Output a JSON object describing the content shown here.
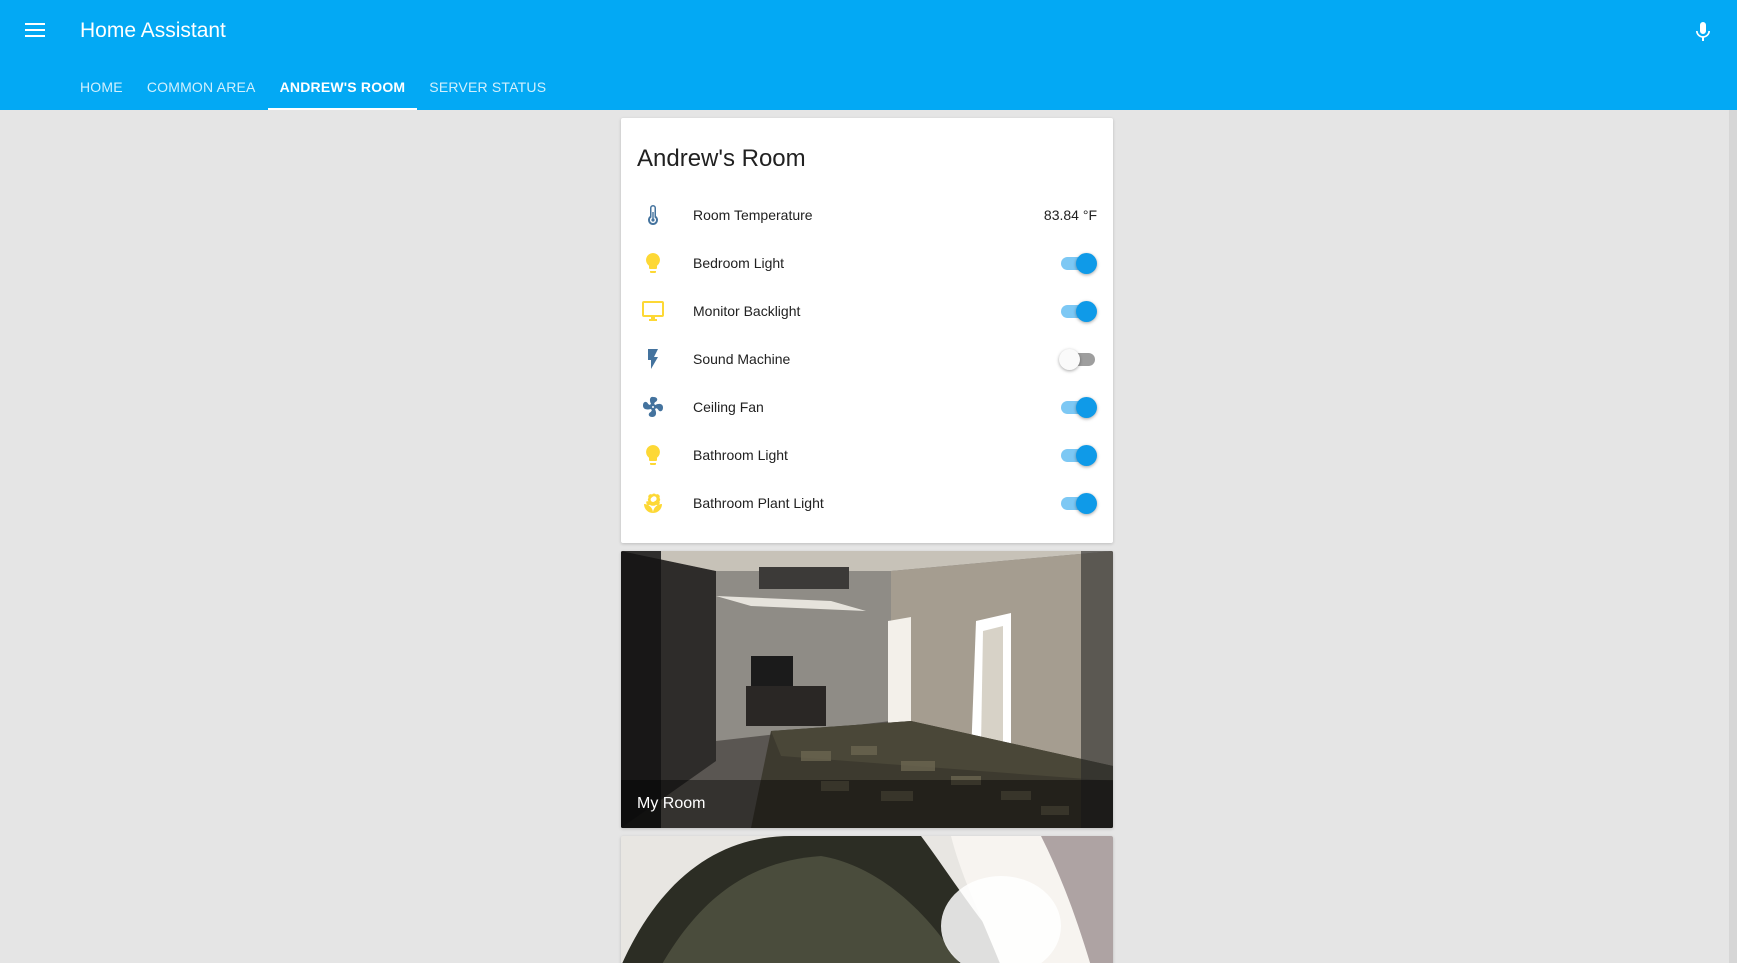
{
  "header": {
    "title": "Home Assistant",
    "tabs": [
      {
        "label": "HOME",
        "active": false
      },
      {
        "label": "COMMON AREA",
        "active": false
      },
      {
        "label": "ANDREW'S ROOM",
        "active": true
      },
      {
        "label": "SERVER STATUS",
        "active": false
      }
    ],
    "menu_icon": "menu-icon",
    "mic_icon": "microphone-icon"
  },
  "colors": {
    "header_bg": "#03a9f4",
    "toggle_on": "#0f9ae8",
    "icon_blue": "#44739e",
    "icon_yellow": "#fdd835"
  },
  "entities_card": {
    "title": "Andrew's Room",
    "rows": [
      {
        "icon": "thermometer-icon",
        "label": "Room Temperature",
        "state": "83.84 °F"
      },
      {
        "icon": "lightbulb-icon",
        "label": "Bedroom Light",
        "on": true
      },
      {
        "icon": "monitor-icon",
        "label": "Monitor Backlight",
        "on": true
      },
      {
        "icon": "flash-icon",
        "label": "Sound Machine",
        "on": false
      },
      {
        "icon": "fan-icon",
        "label": "Ceiling Fan",
        "on": true
      },
      {
        "icon": "lightbulb-icon",
        "label": "Bathroom Light",
        "on": true
      },
      {
        "icon": "flower-icon",
        "label": "Bathroom Plant Light",
        "on": true
      }
    ]
  },
  "camera_cards": [
    {
      "caption": "My Room"
    },
    {
      "caption": ""
    }
  ]
}
